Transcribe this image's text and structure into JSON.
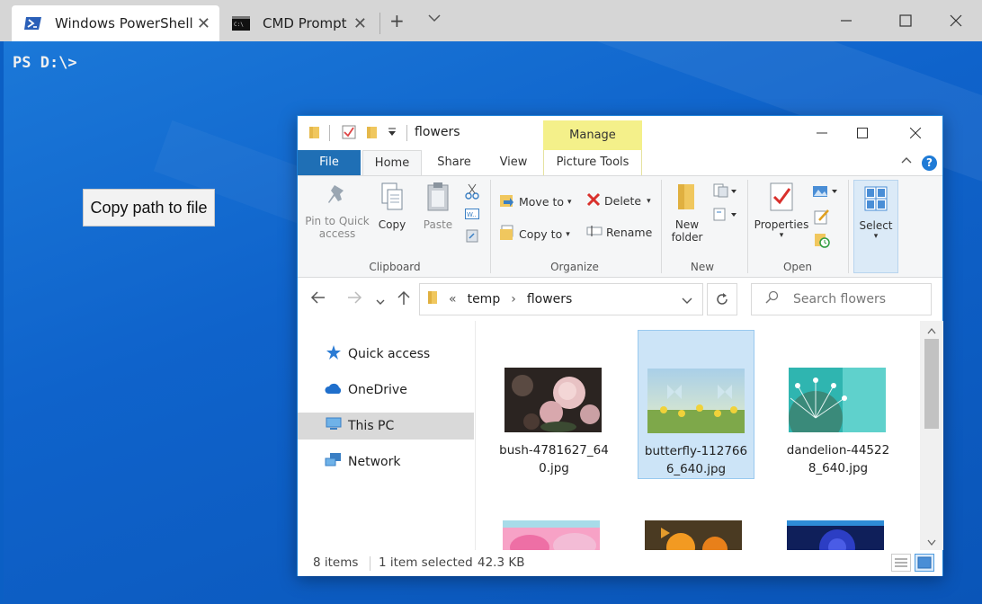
{
  "terminal": {
    "tabs": [
      {
        "label": "Windows PowerShell",
        "active": true
      },
      {
        "label": "CMD Prompt",
        "active": false
      }
    ],
    "prompt_text": "PS D:\\>",
    "new_tab_symbol": "+",
    "dropdown_symbol": "⌄"
  },
  "desktop": {
    "copy_button_label": "Copy path to file"
  },
  "explorer": {
    "title": "flowers",
    "context_tab": "Manage",
    "ribbon_tabs": [
      "File",
      "Home",
      "Share",
      "View",
      "Picture Tools"
    ],
    "clipboard": {
      "pin_label": "Pin to Quick access",
      "copy_label": "Copy",
      "paste_label": "Paste",
      "group_label": "Clipboard"
    },
    "organize": {
      "move_to": "Move to",
      "copy_to": "Copy to",
      "delete": "Delete",
      "rename": "Rename",
      "group_label": "Organize"
    },
    "new": {
      "new_folder": "New folder",
      "group_label": "New"
    },
    "open": {
      "properties": "Properties",
      "group_label": "Open"
    },
    "select": {
      "label": "Select"
    },
    "address": {
      "overflow": "«",
      "crumbs": [
        "temp",
        "flowers"
      ]
    },
    "search": {
      "placeholder": "Search flowers"
    },
    "nav": [
      {
        "label": "Quick access",
        "icon": "star-icon"
      },
      {
        "label": "OneDrive",
        "icon": "cloud-icon"
      },
      {
        "label": "This PC",
        "icon": "computer-icon",
        "selected": true
      },
      {
        "label": "Network",
        "icon": "network-icon"
      }
    ],
    "files": [
      {
        "name": "bush-4781627_640.jpg",
        "selected": false
      },
      {
        "name": "butterfly-1127666_640.jpg",
        "selected": true
      },
      {
        "name": "dandelion-445228_640.jpg",
        "selected": false
      }
    ],
    "status": {
      "items": "8 items",
      "selected": "1 item selected",
      "size": "42.3 KB"
    }
  },
  "colors": {
    "desktop": "#0b5fc4",
    "file_tab": "#1f6fb5",
    "manage_tab": "#f4f08a",
    "selection": "#cce4f7"
  }
}
